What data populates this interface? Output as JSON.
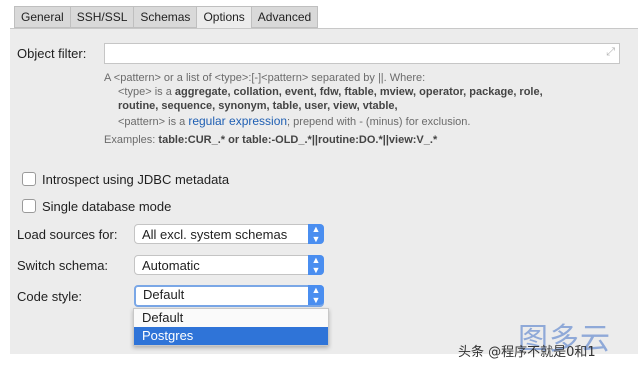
{
  "tabs": [
    "General",
    "SSH/SSL",
    "Schemas",
    "Options",
    "Advanced"
  ],
  "active_tab": "Options",
  "object_filter": {
    "label": "Object filter:",
    "value": ""
  },
  "help": {
    "line1": "A <pattern> or a list of <type>:[-]<pattern> separated by ||. Where:",
    "line2_prefix": "<type> is a ",
    "line2_types": "aggregate, collation, event, fdw, ftable, mview, operator, package, role,",
    "line3_types": "routine, sequence, synonym, table, user, view, vtable,",
    "line4_prefix": "<pattern> is a ",
    "line4_link": "regular expression",
    "line4_suffix": "; prepend with - (minus) for exclusion.",
    "examples_prefix": "Examples: ",
    "examples_text": "table:CUR_.* or table:-OLD_.*||routine:DO.*||view:V_.*"
  },
  "checkboxes": [
    {
      "label": "Introspect using JDBC metadata",
      "checked": false
    },
    {
      "label": "Single database mode",
      "checked": false
    }
  ],
  "fields": {
    "load_sources": {
      "label": "Load sources for:",
      "value": "All excl. system schemas"
    },
    "switch_schema": {
      "label": "Switch schema:",
      "value": "Automatic"
    },
    "code_style": {
      "label": "Code style:",
      "value": "Default"
    }
  },
  "code_style_options": [
    "Default",
    "Postgres"
  ],
  "code_style_highlighted": "Postgres",
  "watermark": {
    "logo": "图多云",
    "caption": "头条 @程序不就是0和1"
  },
  "colors": {
    "accent": "#4a8ef0",
    "selection": "#2f74d8",
    "panel": "#ececec",
    "link": "#1f5fb3"
  }
}
